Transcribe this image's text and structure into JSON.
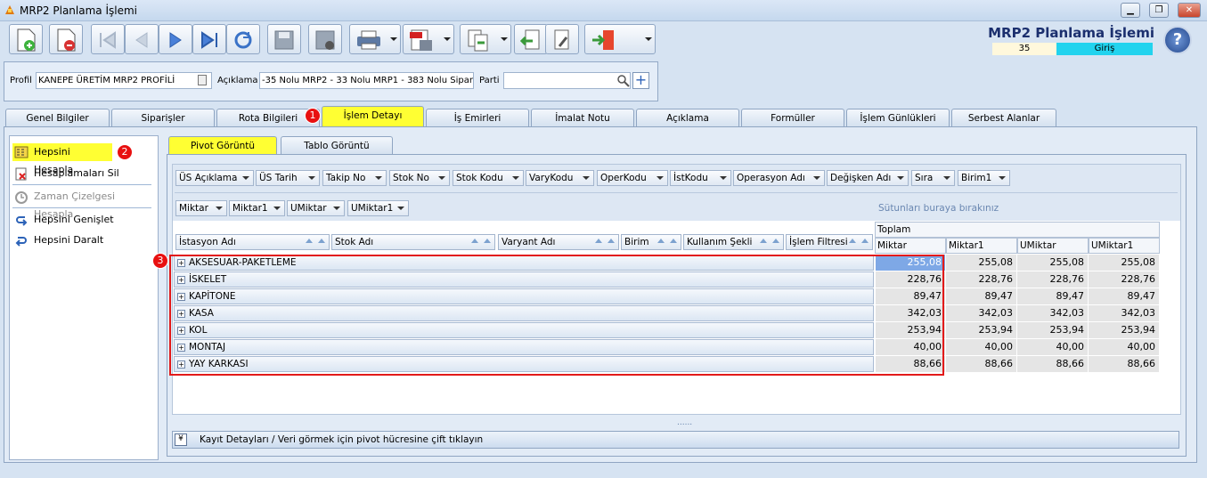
{
  "window": {
    "title": "MRP2 Planlama İşlemi",
    "minimize": "▁",
    "maximize": "❐",
    "close": "✕"
  },
  "header": {
    "title": "MRP2 Planlama İşlemi",
    "number": "35",
    "status": "Giriş",
    "help": "?"
  },
  "profile": {
    "profile_label": "Profil",
    "profile_value": "KANEPE ÜRETİM MRP2 PROFİLİ",
    "desc_label": "Açıklama",
    "desc_value": "-35 Nolu MRP2 - 33 Nolu MRP1 - 383 Nolu Sipariş",
    "parti_label": "Parti",
    "parti_value": ""
  },
  "tabs": [
    "Genel Bilgiler",
    "Siparişler",
    "Rota Bilgileri",
    "İşlem Detayı",
    "İş Emirleri",
    "İmalat Notu",
    "Açıklama",
    "Formüller",
    "İşlem Günlükleri",
    "Serbest Alanlar"
  ],
  "left_panel": {
    "items": [
      "Hepsini Hesapla",
      "Hesaplamaları Sil",
      "Zaman Çizelgesi Hesapla",
      "Hepsini Genişlet",
      "Hepsini Daralt"
    ]
  },
  "badges": [
    "1",
    "2",
    "3"
  ],
  "subtabs": [
    "Pivot Görüntü",
    "Tablo Görüntü"
  ],
  "filter_fields": [
    "ÜS Açıklama",
    "ÜS Tarih",
    "Takip No",
    "Stok No",
    "Stok Kodu",
    "VaryKodu",
    "OperKodu",
    "İstKodu",
    "Operasyon Adı",
    "Değişken Adı",
    "Sıra",
    "Birim1"
  ],
  "data_fields": [
    "Miktar",
    "Miktar1",
    "UMiktar",
    "UMiktar1"
  ],
  "drop_hint": "Sütunları buraya bırakınız",
  "row_fields": [
    "İstasyon Adı",
    "Stok Adı",
    "Varyant Adı",
    "Birim",
    "Kullanım Şekli",
    "İşlem Filtresi"
  ],
  "grid": {
    "total_label": "Toplam",
    "columns": [
      "Miktar",
      "Miktar1",
      "UMiktar",
      "UMiktar1"
    ],
    "rows": [
      {
        "label": "AKSESUAR-PAKETLEME",
        "values": [
          "255,08",
          "255,08",
          "255,08",
          "255,08"
        ]
      },
      {
        "label": "İSKELET",
        "values": [
          "228,76",
          "228,76",
          "228,76",
          "228,76"
        ]
      },
      {
        "label": "KAPİTONE",
        "values": [
          "89,47",
          "89,47",
          "89,47",
          "89,47"
        ]
      },
      {
        "label": "KASA",
        "values": [
          "342,03",
          "342,03",
          "342,03",
          "342,03"
        ]
      },
      {
        "label": "KOL",
        "values": [
          "253,94",
          "253,94",
          "253,94",
          "253,94"
        ]
      },
      {
        "label": "MONTAJ",
        "values": [
          "40,00",
          "40,00",
          "40,00",
          "40,00"
        ]
      },
      {
        "label": "YAY KARKASI",
        "values": [
          "88,66",
          "88,66",
          "88,66",
          "88,66"
        ]
      }
    ]
  },
  "splitter": "......",
  "detail_bar": {
    "button": "¥",
    "text": "Kayıt Detayları / Veri görmek için pivot hücresine çift tıklayın"
  }
}
